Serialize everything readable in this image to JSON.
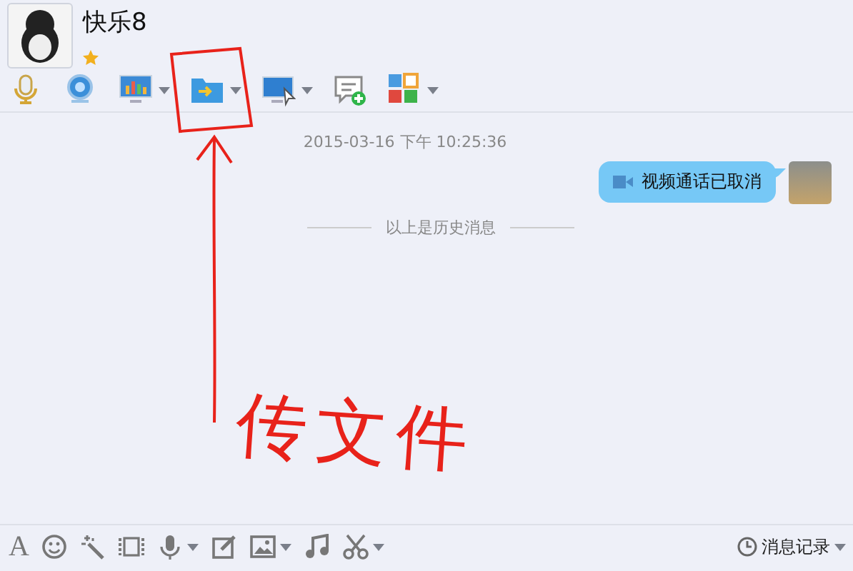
{
  "contact": {
    "name": "快乐8",
    "starred": true
  },
  "top_toolbar": [
    {
      "dropdown": false
    },
    {
      "dropdown": false
    },
    {
      "dropdown": true
    },
    {
      "dropdown": true
    },
    {
      "dropdown": true
    },
    {
      "dropdown": false
    },
    {
      "dropdown": true
    }
  ],
  "chat": {
    "timestamp": "2015-03-16 下午 10:25:36",
    "message": "视频通话已取消",
    "history_divider": "以上是历史消息"
  },
  "bottom_toolbar": [
    {
      "glyph": "A",
      "dropdown": false
    },
    {
      "dropdown": false
    },
    {
      "dropdown": false
    },
    {
      "dropdown": false
    },
    {
      "dropdown": true
    },
    {
      "dropdown": false
    },
    {
      "dropdown": true
    },
    {
      "dropdown": false
    },
    {
      "dropdown": true
    }
  ],
  "history_button": {
    "label": "消息记录",
    "dropdown": true
  },
  "annotation": {
    "text": "传文件"
  }
}
